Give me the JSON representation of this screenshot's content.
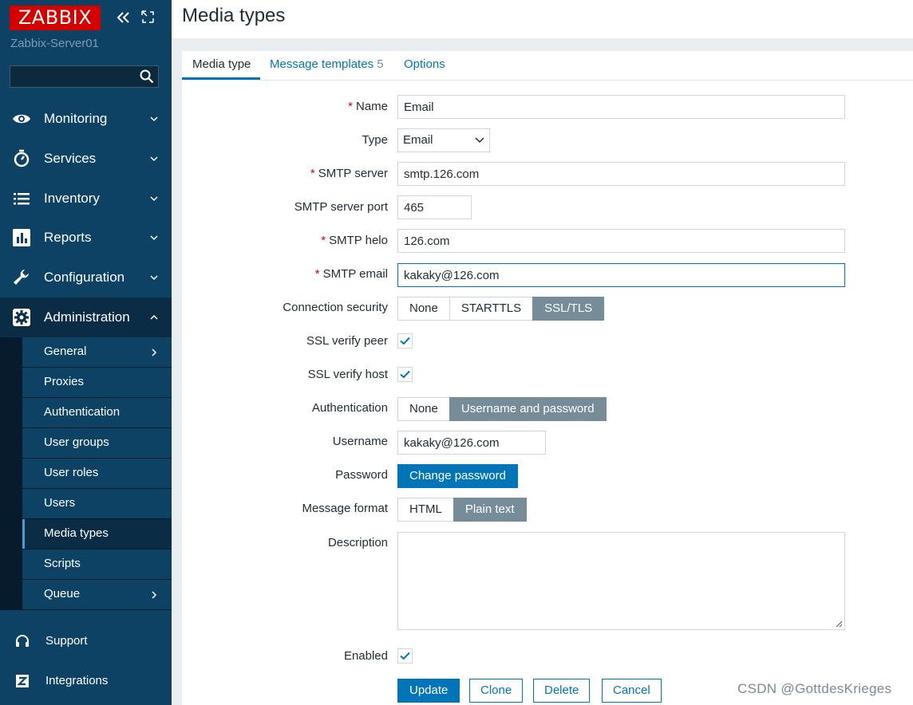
{
  "brand": {
    "logo_text": "ZABBIX",
    "server_name": "Zabbix-Server01"
  },
  "sidebar": {
    "search_value": "",
    "menu": [
      {
        "label": "Monitoring",
        "icon": "eye-icon"
      },
      {
        "label": "Services",
        "icon": "stopwatch-icon"
      },
      {
        "label": "Inventory",
        "icon": "list-icon"
      },
      {
        "label": "Reports",
        "icon": "bar-chart-icon"
      },
      {
        "label": "Configuration",
        "icon": "wrench-icon"
      },
      {
        "label": "Administration",
        "icon": "gear-icon"
      }
    ],
    "submenu": [
      {
        "label": "General",
        "has_arrow": true
      },
      {
        "label": "Proxies"
      },
      {
        "label": "Authentication"
      },
      {
        "label": "User groups"
      },
      {
        "label": "User roles"
      },
      {
        "label": "Users"
      },
      {
        "label": "Media types",
        "selected": true
      },
      {
        "label": "Scripts"
      },
      {
        "label": "Queue",
        "has_arrow": true
      }
    ],
    "bottom": [
      {
        "label": "Support",
        "icon": "headset-icon"
      },
      {
        "label": "Integrations",
        "icon": "zabbix-z-icon"
      }
    ]
  },
  "page": {
    "title": "Media types"
  },
  "tabs": [
    {
      "label": "Media type",
      "active": true
    },
    {
      "label": "Message templates",
      "count": "5"
    },
    {
      "label": "Options"
    }
  ],
  "form": {
    "name": {
      "label": "Name",
      "value": "Email"
    },
    "type": {
      "label": "Type",
      "value": "Email"
    },
    "smtp_server": {
      "label": "SMTP server",
      "value": "smtp.126.com"
    },
    "smtp_port": {
      "label": "SMTP server port",
      "value": "465"
    },
    "smtp_helo": {
      "label": "SMTP helo",
      "value": "126.com"
    },
    "smtp_email": {
      "label": "SMTP email",
      "value": "kakaky@126.com"
    },
    "connection_security": {
      "label": "Connection security",
      "options": [
        "None",
        "STARTTLS",
        "SSL/TLS"
      ],
      "selected": "SSL/TLS"
    },
    "ssl_verify_peer": {
      "label": "SSL verify peer",
      "checked": true
    },
    "ssl_verify_host": {
      "label": "SSL verify host",
      "checked": true
    },
    "authentication": {
      "label": "Authentication",
      "options": [
        "None",
        "Username and password"
      ],
      "selected": "Username and password"
    },
    "username": {
      "label": "Username",
      "value": "kakaky@126.com"
    },
    "password": {
      "label": "Password",
      "button": "Change password"
    },
    "message_format": {
      "label": "Message format",
      "options": [
        "HTML",
        "Plain text"
      ],
      "selected": "Plain text"
    },
    "description": {
      "label": "Description",
      "value": ""
    },
    "enabled": {
      "label": "Enabled",
      "checked": true
    },
    "required_marker": "*"
  },
  "actions": {
    "update": "Update",
    "clone": "Clone",
    "delete": "Delete",
    "cancel": "Cancel"
  },
  "watermark": "CSDN @GottdesKrieges",
  "colors": {
    "brand_red": "#d40000",
    "sidebar_bg": "#0e4265",
    "accent_blue": "#0275b8",
    "segment_on": "#768d99"
  }
}
